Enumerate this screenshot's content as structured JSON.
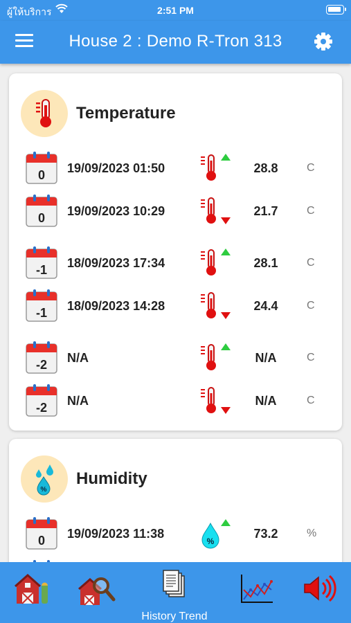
{
  "status_bar": {
    "carrier": "ผู้ให้บริการ",
    "time": "2:51 PM"
  },
  "header": {
    "title": "House 2 : Demo R-Tron 313"
  },
  "temperature": {
    "title": "Temperature",
    "rows": [
      {
        "day": "0",
        "datetime": "19/09/2023  01:50",
        "trend": "up",
        "value": "28.8",
        "unit": "C"
      },
      {
        "day": "0",
        "datetime": "19/09/2023  10:29",
        "trend": "down",
        "value": "21.7",
        "unit": "C"
      },
      {
        "day": "-1",
        "datetime": "18/09/2023  17:34",
        "trend": "up",
        "value": "28.1",
        "unit": "C"
      },
      {
        "day": "-1",
        "datetime": "18/09/2023  14:28",
        "trend": "down",
        "value": "24.4",
        "unit": "C"
      },
      {
        "day": "-2",
        "datetime": "N/A",
        "trend": "up",
        "value": "N/A",
        "unit": "C"
      },
      {
        "day": "-2",
        "datetime": "N/A",
        "trend": "down",
        "value": "N/A",
        "unit": "C"
      }
    ]
  },
  "humidity": {
    "title": "Humidity",
    "rows": [
      {
        "day": "0",
        "datetime": "19/09/2023  11:38",
        "trend": "up",
        "value": "73.2",
        "unit": "%"
      }
    ]
  },
  "tab_bar": {
    "tabs": [
      {
        "icon": "barn-icon"
      },
      {
        "icon": "barn-search-icon"
      },
      {
        "icon": "documents-icon",
        "label": "History Trend"
      },
      {
        "icon": "line-chart-icon"
      },
      {
        "icon": "speaker-icon"
      }
    ]
  },
  "colors": {
    "accent": "#3d96ea",
    "trend_up": "#2ecc40",
    "trend_down": "#e01010",
    "calendar_red": "#e8302a"
  }
}
